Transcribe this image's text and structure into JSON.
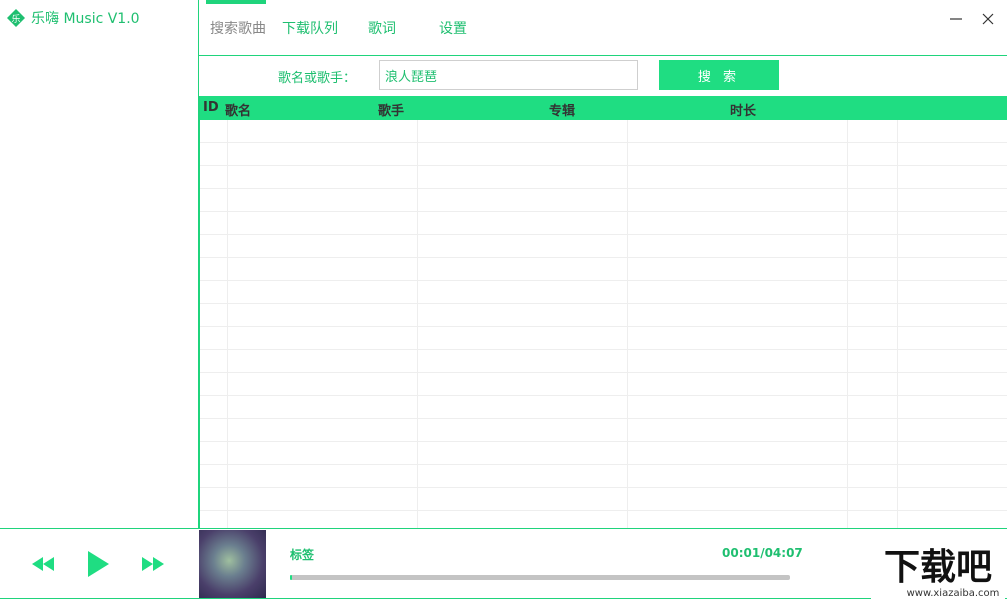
{
  "app": {
    "title": "乐嗨 Music V1.0",
    "logo_char": "乐"
  },
  "nav": {
    "tabs": [
      {
        "label": "搜索歌曲",
        "active": true
      },
      {
        "label": "下载队列",
        "active": false
      },
      {
        "label": "歌词",
        "active": false
      },
      {
        "label": "设置",
        "active": false
      }
    ]
  },
  "window": {
    "minimize_icon": "minimize-icon",
    "close_icon": "close-icon"
  },
  "search": {
    "label": "歌名或歌手：",
    "value": "浪人琵琶",
    "button_label": "搜 索"
  },
  "table": {
    "columns": [
      "ID",
      "歌名",
      "歌手",
      "专辑",
      "时长"
    ],
    "rows": []
  },
  "player": {
    "song_label": "标签",
    "time": "00:01/04:07",
    "progress": 0.004,
    "controls": [
      "rewind-icon",
      "play-icon",
      "fast-forward-icon"
    ]
  },
  "watermark": {
    "text": "下载吧",
    "url": "www.xiazaiba.com"
  },
  "colors": {
    "accent": "#1fdd82",
    "accent_text": "#1fbf70",
    "border": "#1fd47c"
  }
}
